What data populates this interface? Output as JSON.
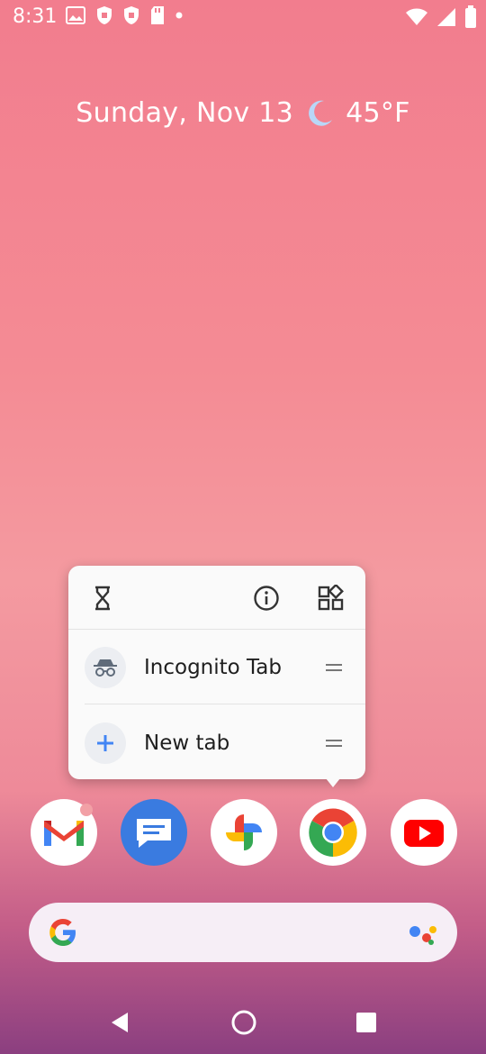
{
  "status_bar": {
    "time": "8:31",
    "left_icons": [
      "gallery-icon",
      "shield-icon",
      "shield-icon",
      "sd-card-icon",
      "notification-dot-icon"
    ],
    "right_icons": [
      "wifi-icon",
      "signal-icon",
      "battery-icon"
    ]
  },
  "at_a_glance": {
    "date": "Sunday, Nov 13",
    "weather_icon": "moon-icon",
    "temperature": "45°F"
  },
  "popup": {
    "top_actions": [
      "hourglass-icon",
      "info-icon",
      "widgets-icon"
    ],
    "shortcuts": [
      {
        "label": "Incognito Tab",
        "icon": "incognito-icon"
      },
      {
        "label": "New tab",
        "icon": "plus-icon"
      }
    ]
  },
  "dock": {
    "apps": [
      "Gmail",
      "Messages",
      "Photos",
      "Chrome",
      "YouTube"
    ]
  },
  "search_bar": {
    "left_icon": "google-g-icon",
    "right_icon": "assistant-icon"
  },
  "nav_bar": {
    "buttons": [
      "back-icon",
      "home-icon",
      "recents-icon"
    ]
  },
  "colors": {
    "google_blue": "#4285F4",
    "google_red": "#EA4335",
    "google_yellow": "#FBBC05",
    "google_green": "#34A853",
    "youtube_red": "#FF0000"
  }
}
